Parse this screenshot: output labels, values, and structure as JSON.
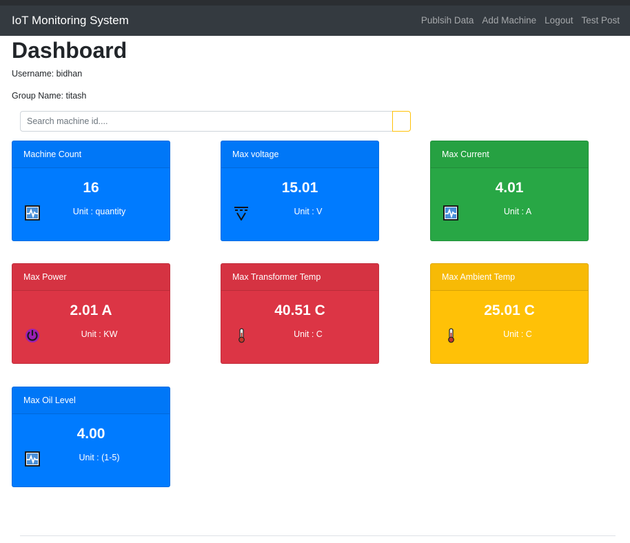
{
  "navbar": {
    "brand": "IoT Monitoring System",
    "links": [
      "Publsih Data",
      "Add Machine",
      "Logout",
      "Test Post"
    ]
  },
  "page": {
    "title": "Dashboard",
    "username": "Username: bidhan",
    "group": "Group Name: titash"
  },
  "search": {
    "placeholder": "Search machine id...."
  },
  "cards": [
    {
      "title": "Machine Count",
      "value": "16",
      "unit": "Unit : quantity",
      "icon": "pulse-monitor-icon",
      "color": "#007bff"
    },
    {
      "title": "Max voltage",
      "value": "15.01",
      "unit": "Unit : V",
      "icon": "voltage-icon",
      "color": "#007bff"
    },
    {
      "title": "Max Current",
      "value": "4.01",
      "unit": "Unit : A",
      "icon": "pulse-monitor-icon",
      "color": "#28a745"
    },
    {
      "title": "Max Power",
      "value": "2.01 A",
      "unit": "Unit : KW",
      "icon": "power-icon",
      "color": "#dc3545"
    },
    {
      "title": "Max Transformer Temp",
      "value": "40.51 C",
      "unit": "Unit : C",
      "icon": "thermometer-icon",
      "color": "#dc3545"
    },
    {
      "title": "Max Ambient Temp",
      "value": "25.01 C",
      "unit": "Unit : C",
      "icon": "thermometer-icon",
      "color": "#ffc107"
    },
    {
      "title": "Max Oil Level",
      "value": "4.00",
      "unit": "Unit : (1-5)",
      "icon": "pulse-monitor-icon",
      "color": "#007bff"
    }
  ]
}
